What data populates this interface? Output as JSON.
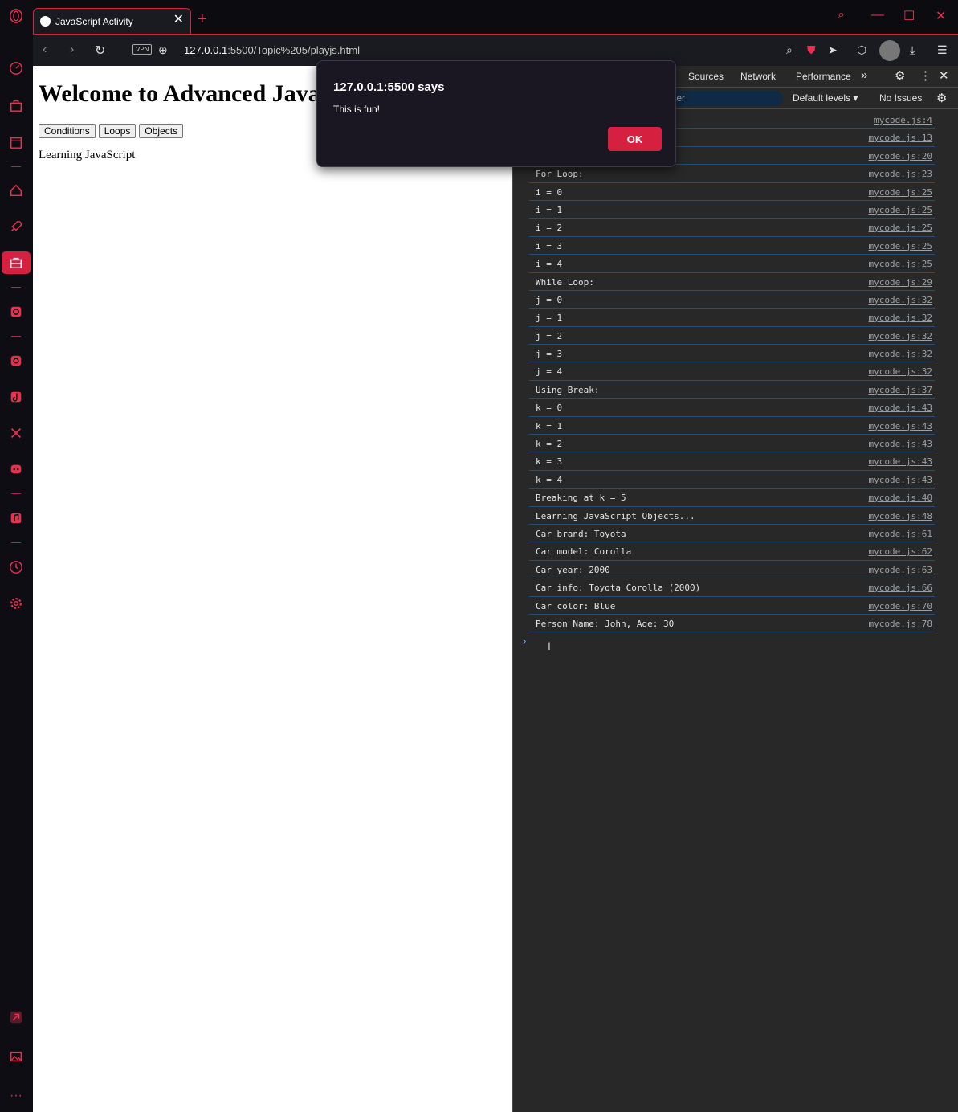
{
  "browser": {
    "tab_title": "JavaScript Activity",
    "url_host": "127.0.0.1",
    "url_rest": ":5500/Topic%205/playjs.html",
    "vpn_label": "VPN",
    "accent": "#d6203f"
  },
  "page": {
    "heading": "Welcome to Advanced JavaS",
    "buttons": [
      "Conditions",
      "Loops",
      "Objects"
    ],
    "paragraph": "Learning JavaScript"
  },
  "devtools": {
    "tabs": [
      "Sources",
      "Network",
      "Performance"
    ],
    "filter_placeholder": "ter",
    "levels_label": "Default levels",
    "issues_label": "No Issues",
    "logs": [
      {
        "msg": "",
        "src": "mycode.js:4"
      },
      {
        "msg": "                     5.",
        "src": "mycode.js:13"
      },
      {
        "msg": "",
        "src": "mycode.js:20"
      },
      {
        "msg": "For Loop:",
        "src": "mycode.js:23"
      },
      {
        "msg": "i = 0",
        "src": "mycode.js:25"
      },
      {
        "msg": "i = 1",
        "src": "mycode.js:25"
      },
      {
        "msg": "i = 2",
        "src": "mycode.js:25"
      },
      {
        "msg": "i = 3",
        "src": "mycode.js:25"
      },
      {
        "msg": "i = 4",
        "src": "mycode.js:25"
      },
      {
        "msg": "While Loop:",
        "src": "mycode.js:29"
      },
      {
        "msg": "j = 0",
        "src": "mycode.js:32"
      },
      {
        "msg": "j = 1",
        "src": "mycode.js:32"
      },
      {
        "msg": "j = 2",
        "src": "mycode.js:32"
      },
      {
        "msg": "j = 3",
        "src": "mycode.js:32"
      },
      {
        "msg": "j = 4",
        "src": "mycode.js:32"
      },
      {
        "msg": "Using Break:",
        "src": "mycode.js:37"
      },
      {
        "msg": "k = 0",
        "src": "mycode.js:43"
      },
      {
        "msg": "k = 1",
        "src": "mycode.js:43"
      },
      {
        "msg": "k = 2",
        "src": "mycode.js:43"
      },
      {
        "msg": "k = 3",
        "src": "mycode.js:43"
      },
      {
        "msg": "k = 4",
        "src": "mycode.js:43"
      },
      {
        "msg": "Breaking at k = 5",
        "src": "mycode.js:40"
      },
      {
        "msg": "Learning JavaScript Objects...",
        "src": "mycode.js:48"
      },
      {
        "msg": "Car brand: Toyota",
        "src": "mycode.js:61"
      },
      {
        "msg": "Car model: Corolla",
        "src": "mycode.js:62"
      },
      {
        "msg": "Car year: 2000",
        "src": "mycode.js:63"
      },
      {
        "msg": "Car info: Toyota Corolla (2000)",
        "src": "mycode.js:66"
      },
      {
        "msg": "Car color: Blue",
        "src": "mycode.js:70"
      },
      {
        "msg": "Person Name: John, Age: 30",
        "src": "mycode.js:78"
      }
    ]
  },
  "dialog": {
    "title": "127.0.0.1:5500 says",
    "message": "This is fun!",
    "ok_label": "OK"
  }
}
